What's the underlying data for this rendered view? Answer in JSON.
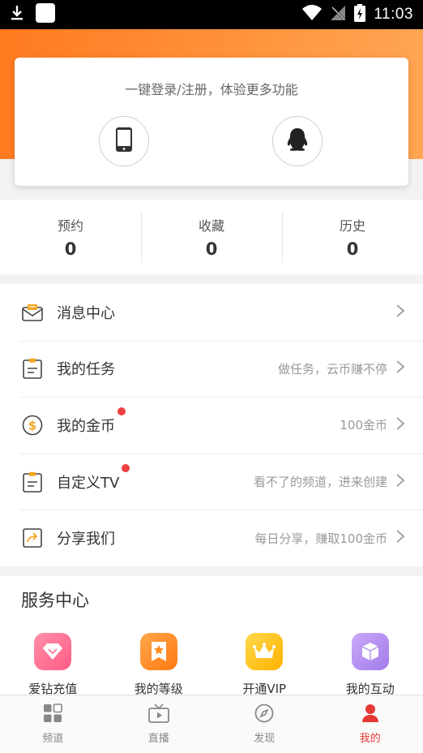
{
  "status_bar": {
    "time": "11:03"
  },
  "login": {
    "prompt": "一键登录/注册，体验更多功能"
  },
  "stats": [
    {
      "label": "预约",
      "value": "0"
    },
    {
      "label": "收藏",
      "value": "0"
    },
    {
      "label": "历史",
      "value": "0"
    }
  ],
  "menu": [
    {
      "label": "消息中心",
      "hint": "",
      "dot": false,
      "icon": "message-icon"
    },
    {
      "label": "我的任务",
      "hint": "做任务，云币赚不停",
      "dot": false,
      "icon": "task-icon"
    },
    {
      "label": "我的金币",
      "hint": "100金币",
      "dot": true,
      "icon": "coin-icon"
    },
    {
      "label": "自定义TV",
      "hint": "看不了的频道，进来创建",
      "dot": true,
      "icon": "custom-tv-icon"
    },
    {
      "label": "分享我们",
      "hint": "每日分享，赚取100金币",
      "dot": false,
      "icon": "share-icon"
    }
  ],
  "service": {
    "title": "服务中心",
    "items": [
      {
        "label": "爱钻充值",
        "icon": "diamond-icon",
        "color": "#ff6f91"
      },
      {
        "label": "我的等级",
        "icon": "level-star-icon",
        "color": "#ff8a1f"
      },
      {
        "label": "开通VIP",
        "icon": "crown-icon",
        "color": "#ffc21a"
      },
      {
        "label": "我的互动",
        "icon": "cube-icon",
        "color": "#b592f0"
      }
    ]
  },
  "tabs": [
    {
      "label": "频道",
      "icon": "grid-icon",
      "active": false
    },
    {
      "label": "直播",
      "icon": "tv-icon",
      "active": false
    },
    {
      "label": "发现",
      "icon": "compass-icon",
      "active": false
    },
    {
      "label": "我的",
      "icon": "user-icon",
      "active": true
    }
  ],
  "colors": {
    "accent": "#ff7a1f",
    "active_tab": "#e53935",
    "dot": "#ee4040"
  }
}
